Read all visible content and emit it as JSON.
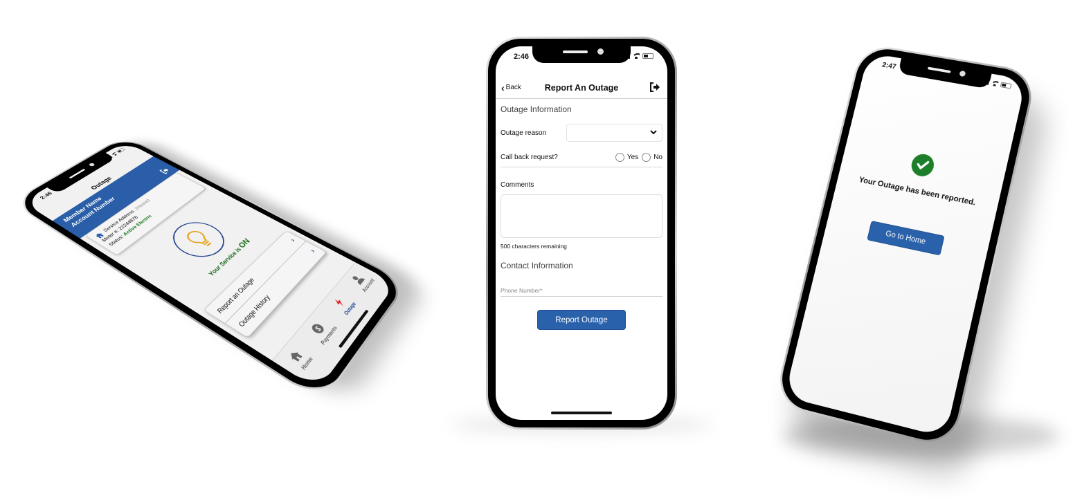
{
  "left_phone": {
    "status_time": "2:46",
    "title": "Outage",
    "member_name": "Member Name",
    "account_number": "Account Number",
    "service_address": "Service Address",
    "service_address_note": "(House)",
    "meter_label": "Meter #:",
    "meter_number": "22244878",
    "status_label": "Status:",
    "status_value": "Active Electric",
    "service_status_prefix": "Your Service is",
    "service_status_value": "ON",
    "menu": [
      {
        "label": "Report an Outage"
      },
      {
        "label": "Outage History"
      }
    ],
    "tabs": [
      {
        "label": "Home",
        "icon": "home-icon"
      },
      {
        "label": "Payments",
        "icon": "dollar-circle-icon"
      },
      {
        "label": "Outage",
        "icon": "lightning-bolt-icon",
        "active": true
      },
      {
        "label": "Account",
        "icon": "user-icon"
      }
    ],
    "colors": {
      "brand_blue": "#2a5ea8",
      "status_green": "#1b7a1b",
      "bulb_orange": "#e6a118",
      "bolt_red": "#e82020"
    }
  },
  "center_phone": {
    "status_time": "2:46",
    "back_label": "Back",
    "title": "Report An Outage",
    "section_outage_info": "Outage Information",
    "outage_reason_label": "Outage reason",
    "outage_reason_value": "",
    "callback_label": "Call back request?",
    "callback_options": [
      "Yes",
      "No"
    ],
    "comments_label": "Comments",
    "comments_value": "",
    "characters_remaining": "500 characters remaining",
    "section_contact_info": "Contact Information",
    "phone_placeholder": "Phone Number*",
    "submit_label": "Report Outage",
    "colors": {
      "button_blue": "#2962ab"
    }
  },
  "right_phone": {
    "status_time": "2:47",
    "message": "Your Outage has been reported.",
    "button_label": "Go to Home",
    "colors": {
      "check_green": "#1e7f2a",
      "button_blue": "#2962ab"
    }
  }
}
